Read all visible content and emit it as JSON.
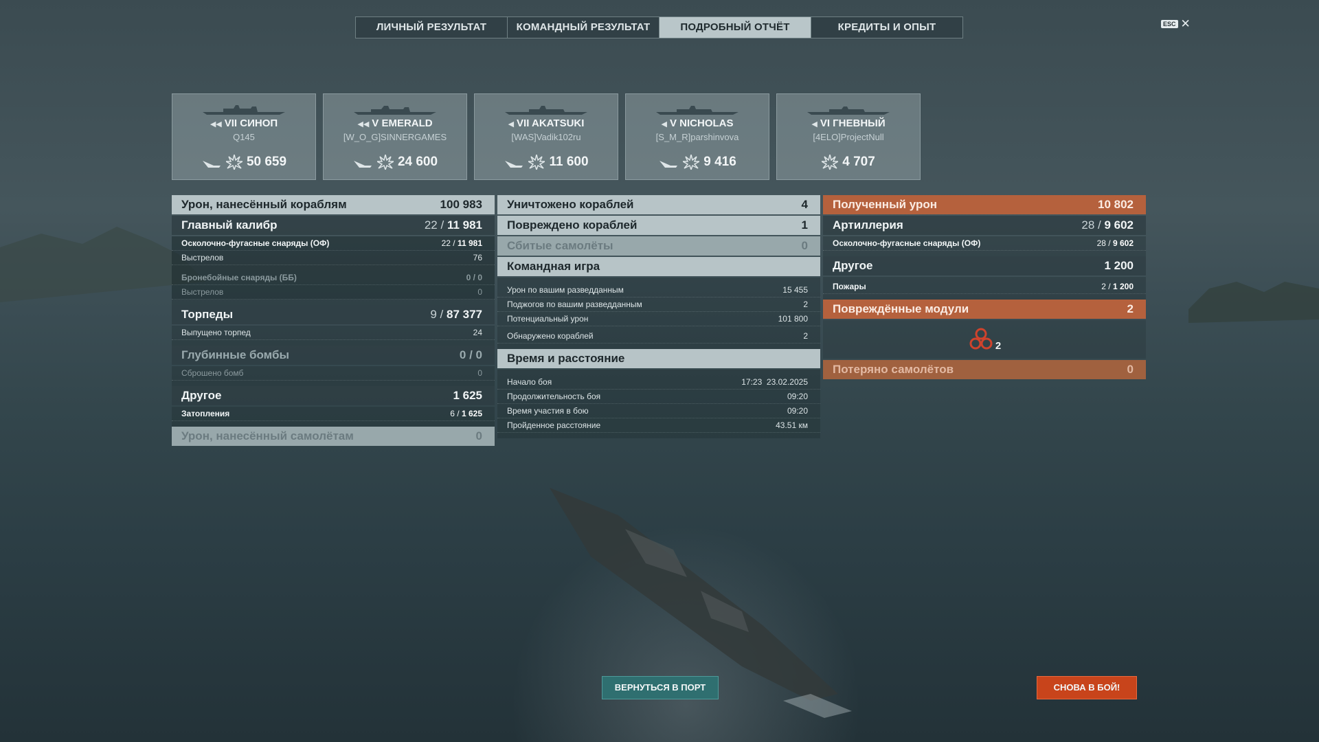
{
  "tabs": [
    {
      "label": "ЛИЧНЫЙ РЕЗУЛЬТАТ",
      "active": false
    },
    {
      "label": "КОМАНДНЫЙ РЕЗУЛЬТАТ",
      "active": false
    },
    {
      "label": "ПОДРОБНЫЙ ОТЧЁТ",
      "active": true
    },
    {
      "label": "КРЕДИТЫ И ОПЫТ",
      "active": false
    }
  ],
  "esc": {
    "key": "ESC",
    "close": "✕"
  },
  "ships": [
    {
      "tier": "VII",
      "name": "СИНОП",
      "player": "Q145",
      "damage": "50 659"
    },
    {
      "tier": "V",
      "name": "EMERALD",
      "player": "[W_O_G]SINNERGAMES",
      "damage": "24 600"
    },
    {
      "tier": "VII",
      "name": "AKATSUKI",
      "player": "[WAS]Vadik102ru",
      "damage": "11 600"
    },
    {
      "tier": "V",
      "name": "NICHOLAS",
      "player": "[S_M_R]parshinvova",
      "damage": "9 416"
    },
    {
      "tier": "VI",
      "name": "ГНЕВНЫЙ",
      "player": "[4ELO]ProjectNull",
      "damage": "4 707"
    }
  ],
  "left": {
    "ship_damage": {
      "label": "Урон, нанесённый кораблям",
      "value": "100 983"
    },
    "main_battery": {
      "label": "Главный калибр",
      "hits": "22 /",
      "value": "11 981"
    },
    "he": {
      "label": "Осколочно-фугасные снаряды (ОФ)",
      "hits": "22 /",
      "value": "11 981"
    },
    "he_shots": {
      "label": "Выстрелов",
      "value": "76"
    },
    "ap": {
      "label": "Бронебойные снаряды (ББ)",
      "value": "0 / 0"
    },
    "ap_shots": {
      "label": "Выстрелов",
      "value": "0"
    },
    "torpedoes": {
      "label": "Торпеды",
      "hits": "9 /",
      "value": "87 377"
    },
    "torp_launched": {
      "label": "Выпущено торпед",
      "value": "24"
    },
    "depth": {
      "label": "Глубинные бомбы",
      "value": "0 / 0"
    },
    "depth_dropped": {
      "label": "Сброшено бомб",
      "value": "0"
    },
    "other": {
      "label": "Другое",
      "value": "1 625"
    },
    "flooding": {
      "label": "Затопления",
      "hits": "6 /",
      "value": "1 625"
    },
    "plane_damage": {
      "label": "Урон, нанесённый самолётам",
      "value": "0"
    }
  },
  "middle": {
    "destroyed": {
      "label": "Уничтожено кораблей",
      "value": "4"
    },
    "damaged": {
      "label": "Повреждено кораблей",
      "value": "1"
    },
    "planes": {
      "label": "Сбитые самолёты",
      "value": "0"
    },
    "team": {
      "label": "Командная игра"
    },
    "spot_damage": {
      "label": "Урон по вашим разведданным",
      "value": "15 455"
    },
    "spot_fires": {
      "label": "Поджогов по вашим разведданным",
      "value": "2"
    },
    "potential": {
      "label": "Потенциальный урон",
      "value": "101 800"
    },
    "spotted": {
      "label": "Обнаружено кораблей",
      "value": "2"
    },
    "time": {
      "label": "Время и расстояние"
    },
    "start": {
      "label": "Начало боя",
      "value": "17:23  23.02.2025"
    },
    "duration": {
      "label": "Продолжительность боя",
      "value": "09:20"
    },
    "participation": {
      "label": "Время участия в бою",
      "value": "09:20"
    },
    "distance": {
      "label": "Пройденное расстояние",
      "value": "43.51 км"
    }
  },
  "right": {
    "received": {
      "label": "Полученный урон",
      "value": "10 802"
    },
    "artillery": {
      "label": "Артиллерия",
      "hits": "28 /",
      "value": "9 602"
    },
    "he": {
      "label": "Осколочно-фугасные снаряды (ОФ)",
      "hits": "28 /",
      "value": "9 602"
    },
    "other": {
      "label": "Другое",
      "value": "1 200"
    },
    "fires": {
      "label": "Пожары",
      "hits": "2 /",
      "value": "1 200"
    },
    "modules": {
      "label": "Повреждённые модули",
      "value": "2",
      "count": "2"
    },
    "planes_lost": {
      "label": "Потеряно самолётов",
      "value": "0"
    }
  },
  "buttons": {
    "port": "ВЕРНУТЬСЯ В ПОРТ",
    "again": "СНОВА В БОЙ!"
  },
  "colors": {
    "accent_orange": "#b5613d",
    "button_teal": "#2f6f70",
    "button_red": "#c8441b"
  }
}
